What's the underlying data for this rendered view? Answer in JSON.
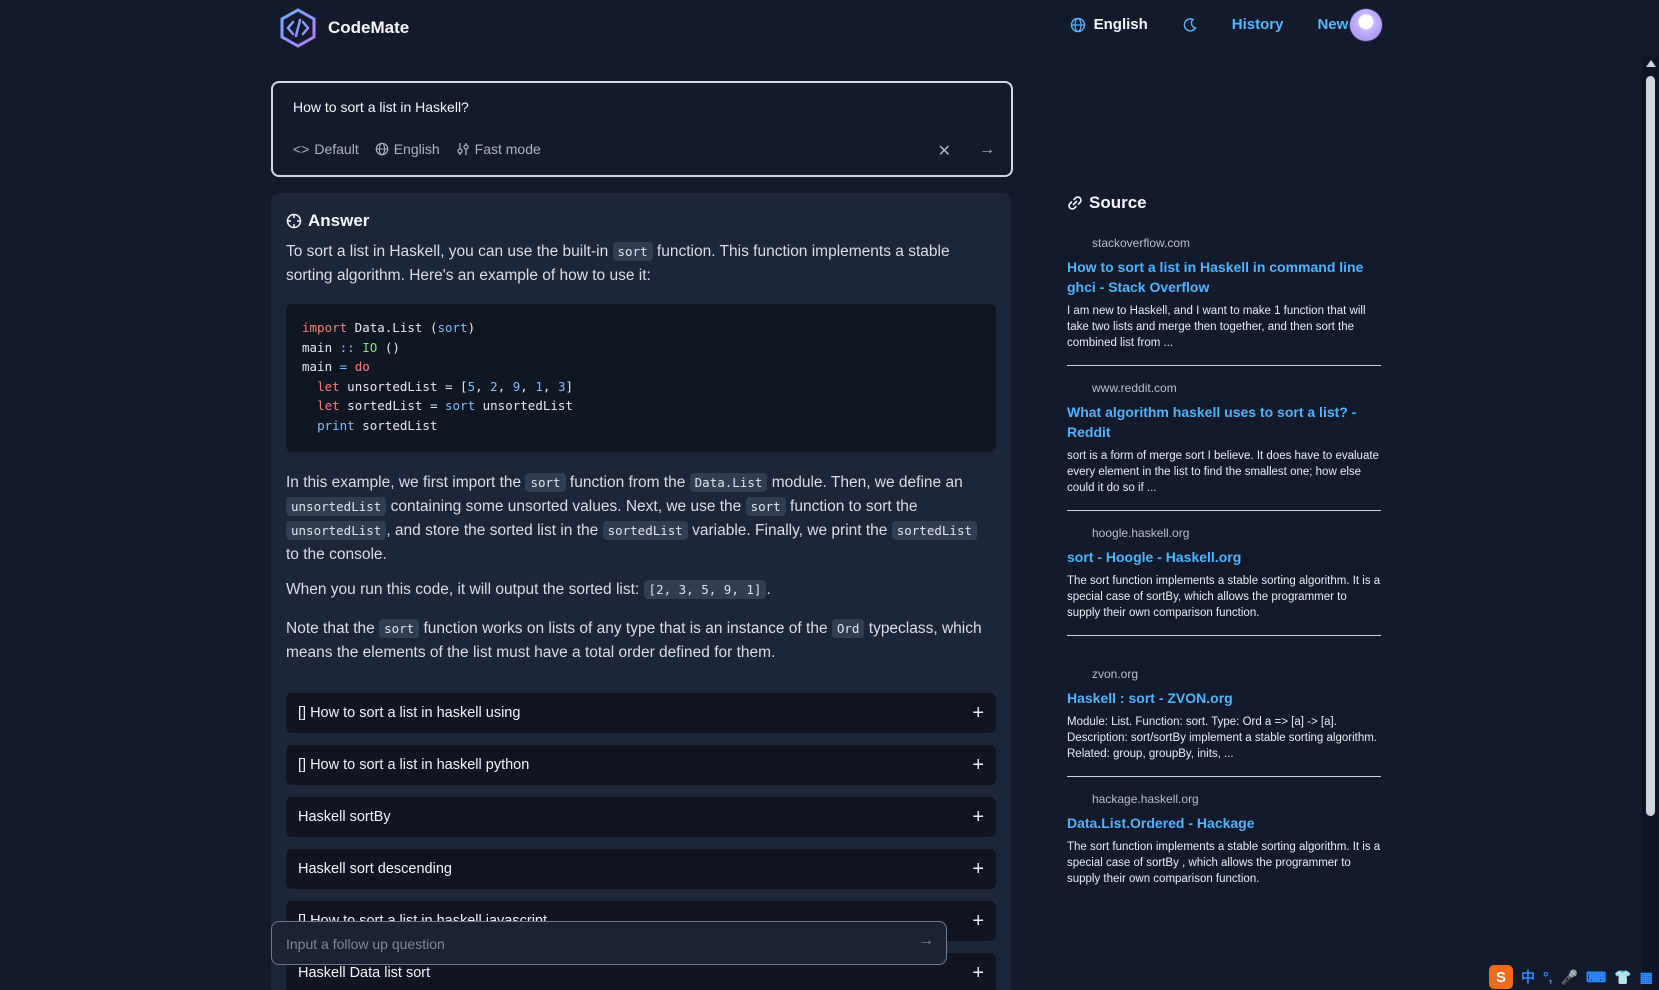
{
  "header": {
    "brand": "CodeMate",
    "language": "English",
    "history": "History",
    "newest": "Newest"
  },
  "query": {
    "text": "How to sort a list in Haskell?",
    "mode_default": "Default",
    "mode_language": "English",
    "mode_fast": "Fast mode"
  },
  "answer": {
    "title": "Answer",
    "p1_a": "To sort a list in Haskell, you can use the built-in ",
    "p1_code": "sort",
    "p1_b": " function. This function implements a stable sorting algorithm. Here's an example of how to use it:",
    "p2_a": "In this example, we first import the ",
    "p2_c1": "sort",
    "p2_b": " function from the ",
    "p2_c2": "Data.List",
    "p2_c": " module. Then, we define an ",
    "p2_c3": "unsortedList",
    "p2_d": " containing some unsorted values. Next, we use the ",
    "p2_c4": "sort",
    "p2_e": " function to sort the ",
    "p2_c5": "unsortedList",
    "p2_f": ", and store the sorted list in the ",
    "p2_c6": "sortedList",
    "p2_g": " variable. Finally, we print the ",
    "p2_c7": "sortedList",
    "p2_h": " to the console.",
    "p3_a": "When you run this code, it will output the sorted list: ",
    "p3_code": "[2, 3, 5, 9, 1]",
    "p3_b": ".",
    "p4_a": "Note that the ",
    "p4_c1": "sort",
    "p4_b": " function works on lists of any type that is an instance of the ",
    "p4_c2": "Ord",
    "p4_c": " typeclass, which means the elements of the list must have a total order defined for them."
  },
  "code": {
    "l1_kw": "import",
    "l1_mod": " Data.List (",
    "l1_fn": "sort",
    "l1_end": ")",
    "l2_a": "main ",
    "l2_op": "::",
    "l2_sp": " ",
    "l2_ty": "IO",
    "l2_b": " ()",
    "l3_a": "main ",
    "l3_op": "=",
    "l3_sp": " ",
    "l3_kw": "do",
    "l4_kw": "let",
    "l4_a": " unsortedList = [",
    "l4_n1": "5",
    "l4_c1": ", ",
    "l4_n2": "2",
    "l4_c2": ", ",
    "l4_n3": "9",
    "l4_c3": ", ",
    "l4_n4": "1",
    "l4_c4": ", ",
    "l4_n5": "3",
    "l4_end": "]",
    "l5_kw": "let",
    "l5_a": " sortedList = ",
    "l5_fn": "sort",
    "l5_b": " unsortedList",
    "l6_fn": "print",
    "l6_a": " sortedList"
  },
  "related": [
    "[] How to sort a list in haskell using",
    "[] How to sort a list in haskell python",
    "Haskell sortBy",
    "Haskell sort descending",
    "[] How to sort a list in haskell javascript",
    "Haskell Data list sort"
  ],
  "followup": {
    "placeholder": "Input a follow up question"
  },
  "sources": {
    "title": "Source",
    "items": [
      {
        "domain": "stackoverflow.com",
        "title": "How to sort a list in Haskell in command line ghci - Stack Overflow",
        "snippet": "I am new to Haskell, and I want to make 1 function that will take two lists and merge then together, and then sort the combined list from ..."
      },
      {
        "domain": "www.reddit.com",
        "title": "What algorithm haskell uses to sort a list? - Reddit",
        "snippet": "sort is a form of merge sort I believe. It does have to evaluate every element in the list to find the smallest one; how else could it do so if ..."
      },
      {
        "domain": "hoogle.haskell.org",
        "title": "sort - Hoogle - Haskell.org",
        "snippet": "The sort function implements a stable sorting algorithm. It is a special case of sortBy, which allows the programmer to supply their own comparison function."
      },
      {
        "domain": "zvon.org",
        "title": "Haskell : sort - ZVON.org",
        "snippet": "Module: List. Function: sort. Type: Ord a => [a] -> [a]. Description: sort/sortBy implement a stable sorting algorithm. Related: group, groupBy, inits, ..."
      },
      {
        "domain": "hackage.haskell.org",
        "title": "Data.List.Ordered - Hackage",
        "snippet": "The sort function implements a stable sorting algorithm. It is a special case of sortBy , which allows the programmer to supply their own comparison function."
      }
    ]
  },
  "ime": {
    "logo": "S",
    "label": "中"
  },
  "colors": {
    "background": "#121a2b",
    "card": "#1d2638",
    "accent": "#52b6ff"
  }
}
